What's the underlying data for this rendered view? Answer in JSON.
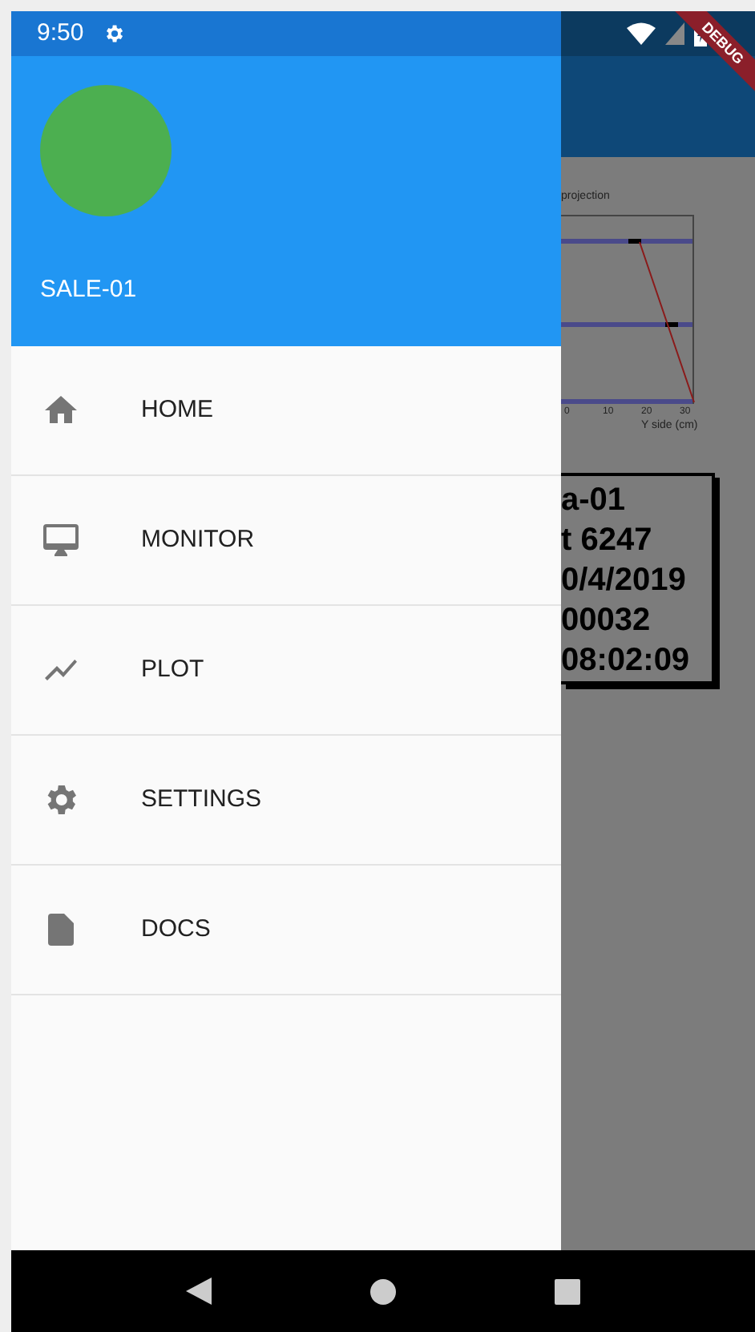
{
  "status_bar": {
    "time": "9:50"
  },
  "debug_banner": {
    "label": "DEBUG"
  },
  "drawer": {
    "header": {
      "title": "SALE-01"
    },
    "items": [
      {
        "kind": "home",
        "label": "HOME"
      },
      {
        "kind": "monitor",
        "label": "MONITOR"
      },
      {
        "kind": "plot",
        "label": "PLOT"
      },
      {
        "kind": "settings",
        "label": "SETTINGS"
      },
      {
        "kind": "docs",
        "label": "DOCS"
      }
    ]
  },
  "background": {
    "chart": {
      "title": "projection",
      "xticks": [
        "0",
        "10",
        "20",
        "30"
      ],
      "xlabel": "Y side (cm)"
    },
    "info_box": {
      "lines": [
        "a-01",
        "t 6247",
        "0/4/2019",
        "00032",
        "08:02:09"
      ]
    }
  }
}
